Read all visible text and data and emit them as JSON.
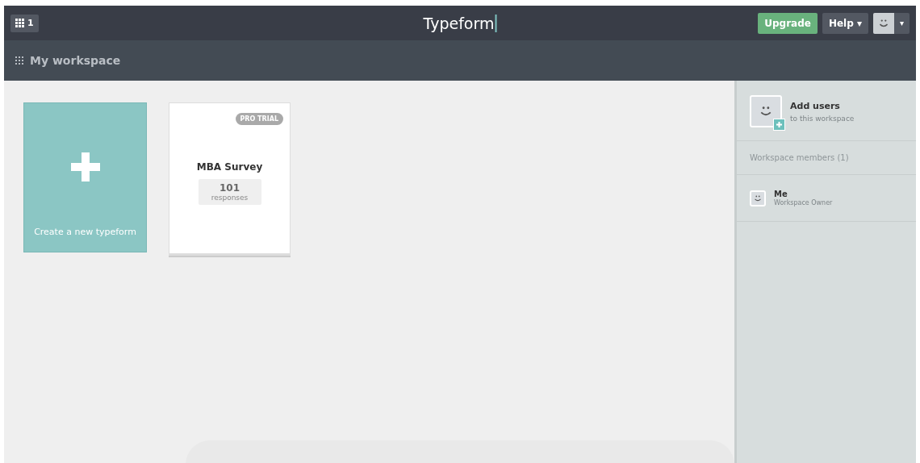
{
  "topbar": {
    "workspaces_count": "1",
    "logo": "Typeform",
    "upgrade": "Upgrade",
    "help": "Help ▾",
    "account_caret": "▾"
  },
  "subbar": {
    "title": "My workspace"
  },
  "create_card": {
    "label": "Create a new typeform"
  },
  "forms": [
    {
      "badge": "PRO TRIAL",
      "title": "MBA Survey",
      "count": "101",
      "count_label": "responses"
    }
  ],
  "sidebar": {
    "add_users": {
      "title": "Add users",
      "subtitle": "to this workspace"
    },
    "members_heading": "Workspace members (1)",
    "members": [
      {
        "name": "Me",
        "role": "Workspace Owner"
      }
    ]
  }
}
